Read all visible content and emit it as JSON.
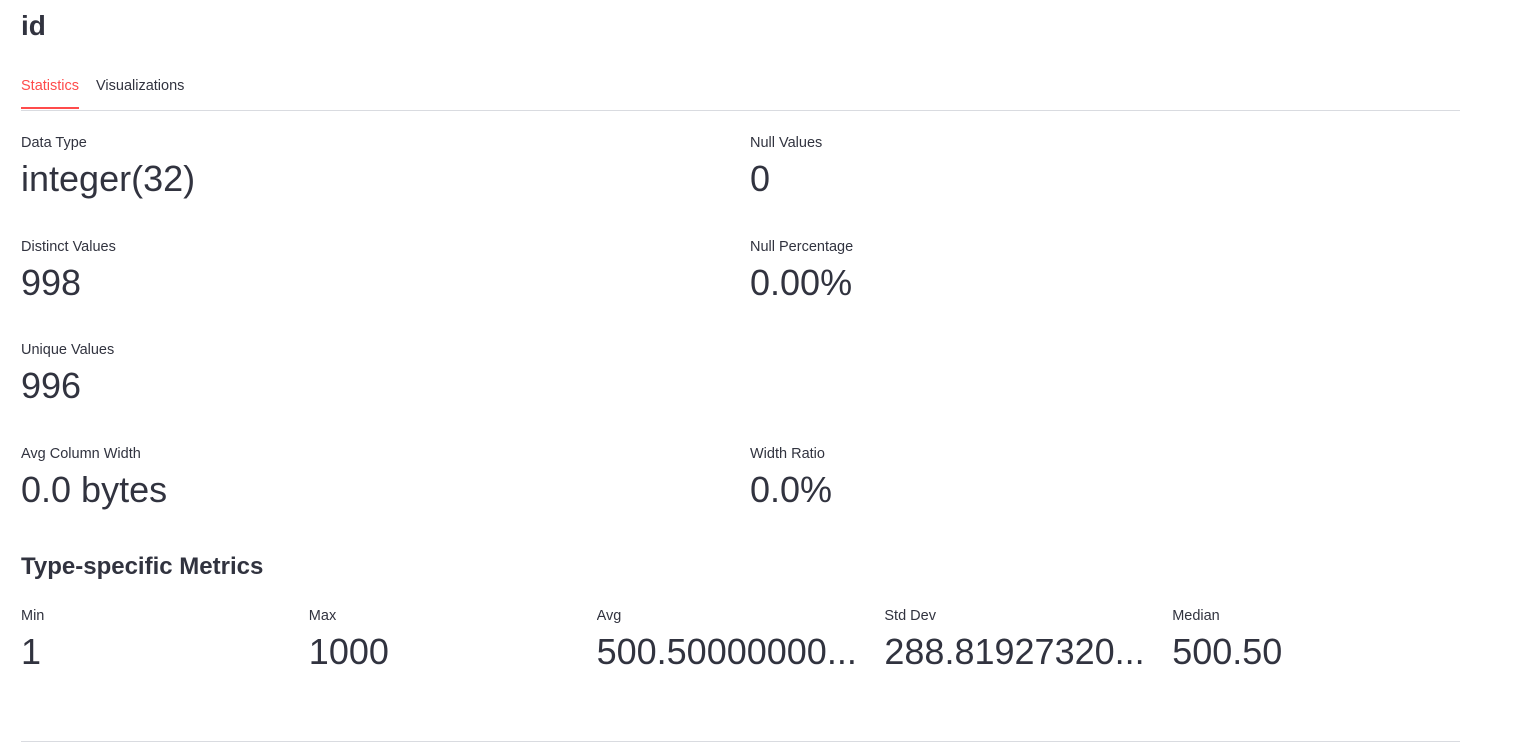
{
  "header": {
    "title": "id"
  },
  "tabs": [
    {
      "label": "Statistics",
      "active": true
    },
    {
      "label": "Visualizations",
      "active": false
    }
  ],
  "metrics": {
    "data_type": {
      "label": "Data Type",
      "value": "integer(32)"
    },
    "null_values": {
      "label": "Null Values",
      "value": "0"
    },
    "distinct_values": {
      "label": "Distinct Values",
      "value": "998"
    },
    "null_percentage": {
      "label": "Null Percentage",
      "value": "0.00%"
    },
    "unique_values": {
      "label": "Unique Values",
      "value": "996"
    },
    "avg_column_width": {
      "label": "Avg Column Width",
      "value": "0.0 bytes"
    },
    "width_ratio": {
      "label": "Width Ratio",
      "value": "0.0%"
    }
  },
  "type_specific": {
    "heading": "Type-specific Metrics",
    "items": [
      {
        "label": "Min",
        "value": "1"
      },
      {
        "label": "Max",
        "value": "1000"
      },
      {
        "label": "Avg",
        "value": "500.50000000..."
      },
      {
        "label": "Std Dev",
        "value": "288.81927320..."
      },
      {
        "label": "Median",
        "value": "500.50"
      }
    ]
  },
  "colors": {
    "accent": "#ff4b4b",
    "text": "#31333f",
    "divider": "#d9dbe0"
  }
}
